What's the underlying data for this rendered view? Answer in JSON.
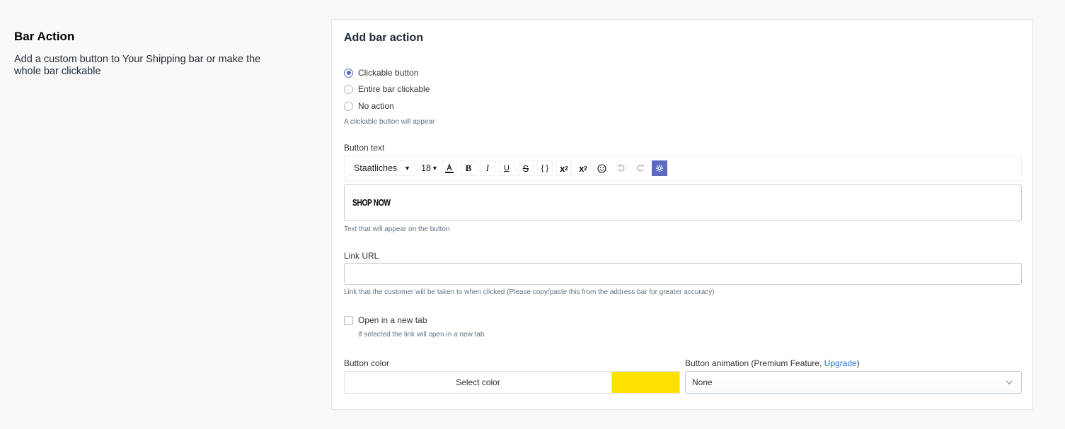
{
  "section": {
    "title": "Bar Action",
    "description": "Add a custom button to Your Shipping bar or make the whole bar clickable"
  },
  "card": {
    "title": "Add bar action",
    "radios": [
      {
        "label": "Clickable button",
        "checked": true
      },
      {
        "label": "Entire bar clickable",
        "checked": false
      },
      {
        "label": "No action",
        "checked": false
      }
    ],
    "radio_help": "A clickable button will appear",
    "button_text": {
      "label": "Button text",
      "font": "Staatliches",
      "size": "18",
      "toolbar_icons": [
        "font-color-icon",
        "bold-icon",
        "italic-icon",
        "underline-icon",
        "strikethrough-icon",
        "code-icon",
        "superscript-icon",
        "subscript-icon",
        "emoji-icon",
        "undo-icon",
        "redo-icon",
        "settings-icon"
      ],
      "value": "SHOP NOW",
      "help": "Text that will appear on the button"
    },
    "link": {
      "label": "Link URL",
      "value": "",
      "help": "Link that the customer will be taken to when clicked (Please copy/paste this from the address bar for greater accuracy)"
    },
    "new_tab": {
      "label": "Open in a new tab",
      "checked": false,
      "help": "If selected the link will open in a new tab"
    },
    "button_color": {
      "label": "Button color",
      "select_label": "Select color",
      "color": "#ffe100"
    },
    "animation": {
      "label_prefix": "Button animation (Premium Feature, ",
      "upgrade_link": "Upgrade",
      "label_suffix": ")",
      "selected": "None"
    }
  },
  "colors": {
    "accent": "#5c6ac4",
    "link": "#1a73e8"
  }
}
